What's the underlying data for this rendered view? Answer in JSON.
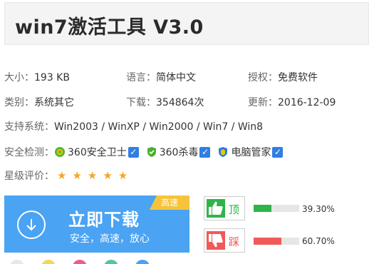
{
  "title": "win7激活工具 V3.0",
  "info": {
    "size_label": "大小：",
    "size_value": "193 KB",
    "lang_label": "语言：",
    "lang_value": "简体中文",
    "license_label": "授权：",
    "license_value": "免费软件",
    "category_label": "类别：",
    "category_value": "系统其它",
    "downloads_label": "下载：",
    "downloads_value": "354864次",
    "updated_label": "更新：",
    "updated_value": "2016-12-09",
    "support_label": "支持系统：",
    "support_value": "Win2003 / WinXP / Win2000 / Win7 / Win8"
  },
  "security": {
    "label": "安全检测：",
    "items": [
      {
        "name": "360安全卫士",
        "icon": "360-safeguard-icon",
        "checked": true
      },
      {
        "name": "360杀毒",
        "icon": "360-antivirus-icon",
        "checked": true
      },
      {
        "name": "电脑管家",
        "icon": "pc-manager-icon",
        "checked": true
      }
    ]
  },
  "rating": {
    "label": "星级评价：",
    "stars": 5,
    "glyphs": "★★★★★"
  },
  "download": {
    "title": "立即下载",
    "subtitle": "安全，高速，放心",
    "badge": "高速"
  },
  "votes": {
    "up_label": "顶",
    "up_percent": "39.30%",
    "up_fraction": 0.393,
    "down_label": "踩",
    "down_percent": "60.70%",
    "down_fraction": 0.607
  },
  "colors": {
    "accent": "#4aa3f3",
    "badge": "#f6c43a",
    "up": "#2fb44a",
    "down": "#f05a5a",
    "star": "#f6a623"
  }
}
